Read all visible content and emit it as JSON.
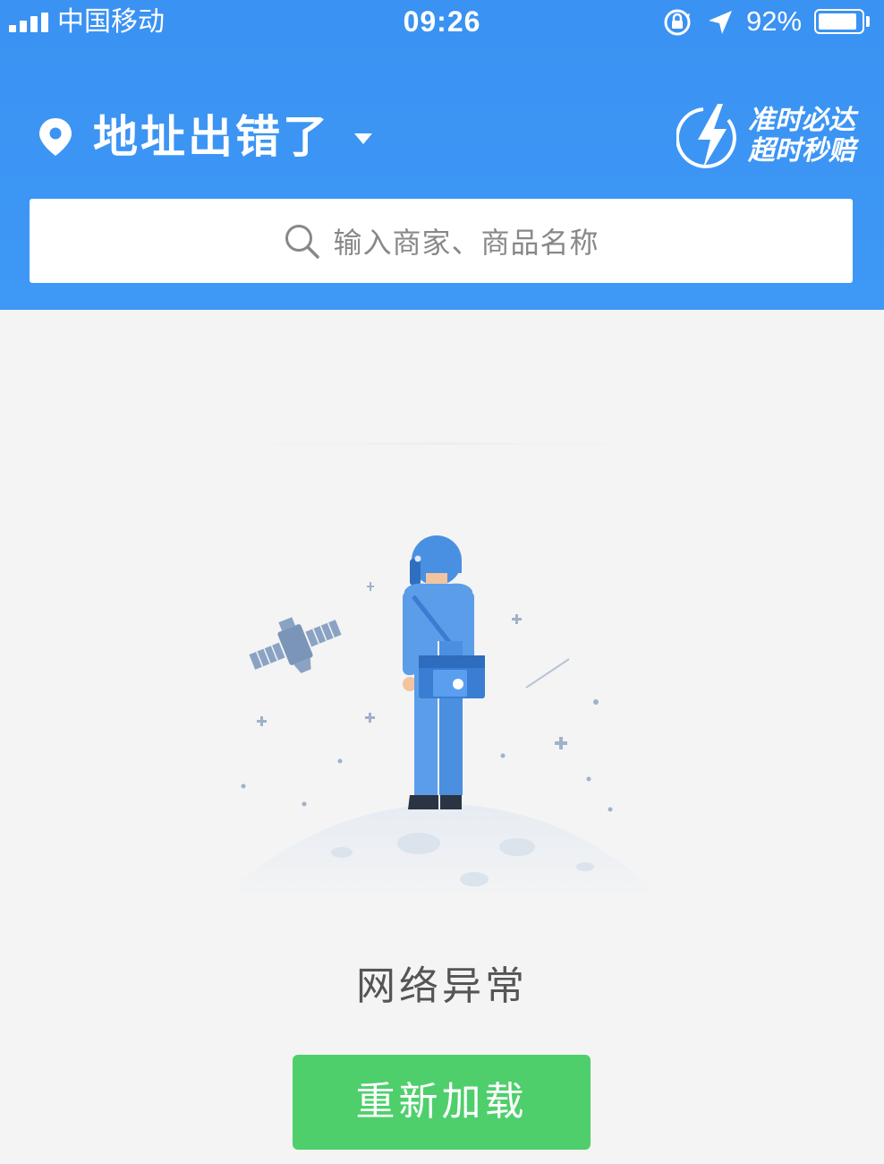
{
  "status_bar": {
    "carrier": "中国移动",
    "time": "09:26",
    "battery_percent": "92%",
    "signal_bars": 4,
    "battery_level": 0.92
  },
  "header": {
    "address": "地址出错了",
    "promise_line1": "准时必达",
    "promise_line2": "超时秒赔"
  },
  "search": {
    "placeholder": "输入商家、商品名称"
  },
  "error": {
    "message": "网络异常",
    "reload_label": "重新加载"
  },
  "colors": {
    "header_blue": "#3a92f2",
    "reload_green": "#4fcf6c",
    "background": "#f4f4f4"
  }
}
